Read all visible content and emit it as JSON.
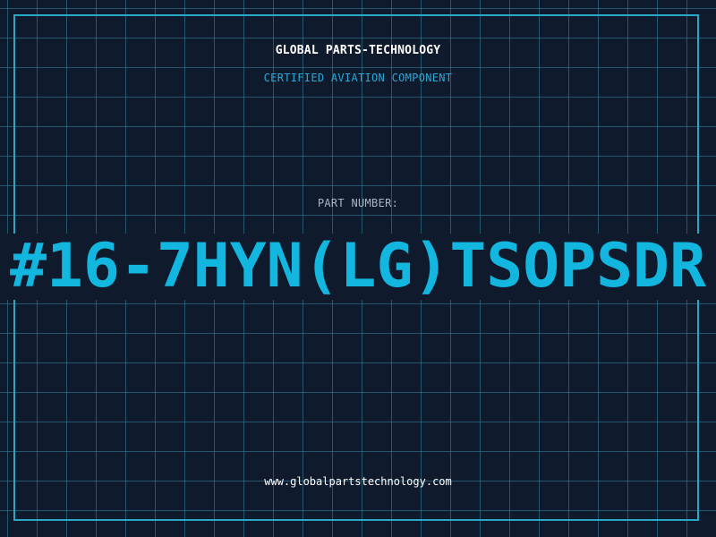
{
  "header": {
    "company": "GLOBAL PARTS-TECHNOLOGY",
    "subtitle": "CERTIFIED AVIATION COMPONENT"
  },
  "part": {
    "label": "PART NUMBER:",
    "number": "#16-7HYN(LG)TSOPSDR"
  },
  "footer": {
    "website": "www.globalpartstechnology.com"
  },
  "colors": {
    "background": "#101a2d",
    "grid": "#2e6f86",
    "accent": "#12b6de",
    "frame": "#2aa7c7",
    "label": "#a9b6c7"
  }
}
